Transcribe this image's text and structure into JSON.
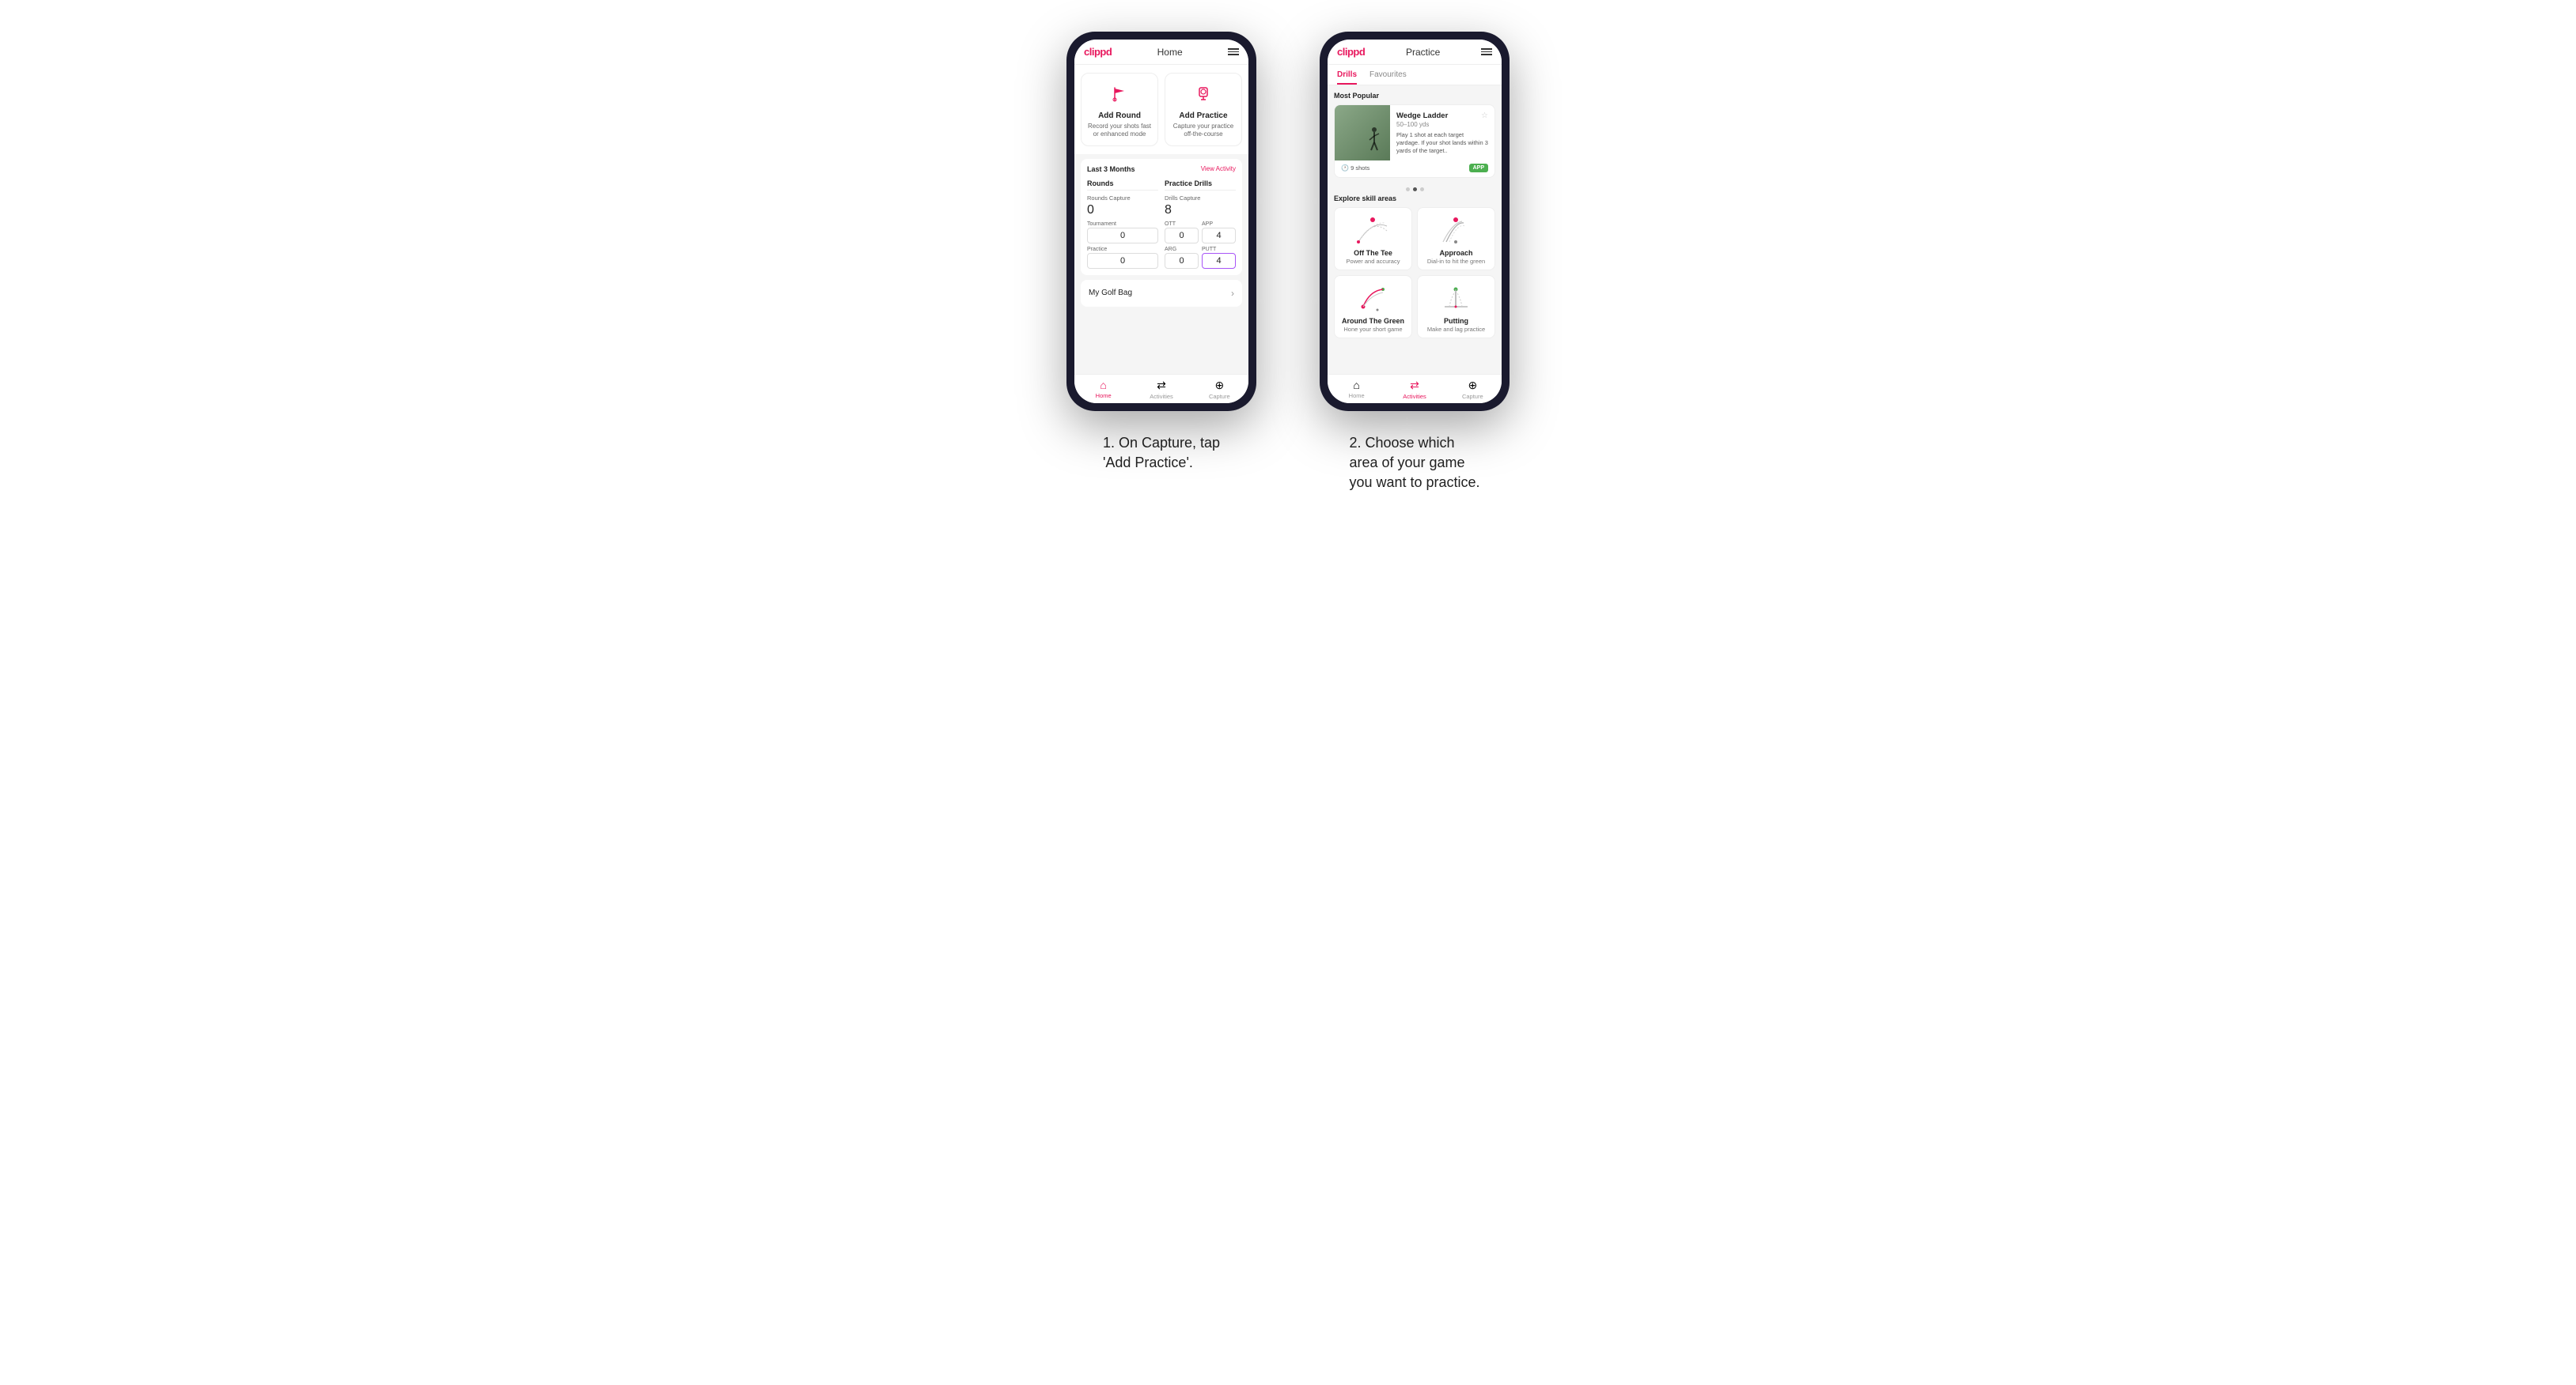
{
  "phone1": {
    "appBar": {
      "logo": "clippd",
      "title": "Home"
    },
    "cards": [
      {
        "id": "add-round",
        "title": "Add Round",
        "desc": "Record your shots fast or enhanced mode",
        "iconType": "flag"
      },
      {
        "id": "add-practice",
        "title": "Add Practice",
        "desc": "Capture your practice off-the-course",
        "iconType": "target"
      }
    ],
    "statsSection": {
      "periodLabel": "Last 3 Months",
      "viewActivityLabel": "View Activity",
      "rounds": {
        "title": "Rounds",
        "captureLabel": "Rounds Capture",
        "captureValue": "0",
        "tournamentLabel": "Tournament",
        "tournamentValue": "0",
        "practiceLabel": "Practice",
        "practiceValue": "0"
      },
      "practiceDrills": {
        "title": "Practice Drills",
        "captureLabel": "Drills Capture",
        "captureValue": "8",
        "ottLabel": "OTT",
        "ottValue": "0",
        "appLabel": "APP",
        "appValue": "4",
        "argLabel": "ARG",
        "argValue": "0",
        "puttLabel": "PUTT",
        "puttValue": "4"
      }
    },
    "golfBag": {
      "label": "My Golf Bag"
    },
    "bottomNav": [
      {
        "label": "Home",
        "active": true,
        "iconType": "home"
      },
      {
        "label": "Activities",
        "active": false,
        "iconType": "activities"
      },
      {
        "label": "Capture",
        "active": false,
        "iconType": "plus-circle"
      }
    ]
  },
  "phone2": {
    "appBar": {
      "logo": "clippd",
      "title": "Practice"
    },
    "tabs": [
      {
        "label": "Drills",
        "active": true
      },
      {
        "label": "Favourites",
        "active": false
      }
    ],
    "mostPopularLabel": "Most Popular",
    "featuredDrill": {
      "title": "Wedge Ladder",
      "yards": "50–100 yds",
      "desc": "Play 1 shot at each target yardage. If your shot lands within 3 yards of the target..",
      "shots": "9 shots",
      "badge": "APP"
    },
    "carouselDots": [
      false,
      true,
      false
    ],
    "exploreLabel": "Explore skill areas",
    "skillAreas": [
      {
        "id": "off-the-tee",
        "title": "Off The Tee",
        "desc": "Power and accuracy",
        "iconType": "arc-dots"
      },
      {
        "id": "approach",
        "title": "Approach",
        "desc": "Dial-in to hit the green",
        "iconType": "arc-lines"
      },
      {
        "id": "around-the-green",
        "title": "Around The Green",
        "desc": "Hone your short game",
        "iconType": "arc-dots-green"
      },
      {
        "id": "putting",
        "title": "Putting",
        "desc": "Make and lag practice",
        "iconType": "putt-lines"
      }
    ],
    "bottomNav": [
      {
        "label": "Home",
        "active": false,
        "iconType": "home"
      },
      {
        "label": "Activities",
        "active": true,
        "iconType": "activities"
      },
      {
        "label": "Capture",
        "active": false,
        "iconType": "plus-circle"
      }
    ]
  },
  "caption1": "1. On Capture, tap\n'Add Practice'.",
  "caption2": "2. Choose which\narea of your game\nyou want to practice."
}
